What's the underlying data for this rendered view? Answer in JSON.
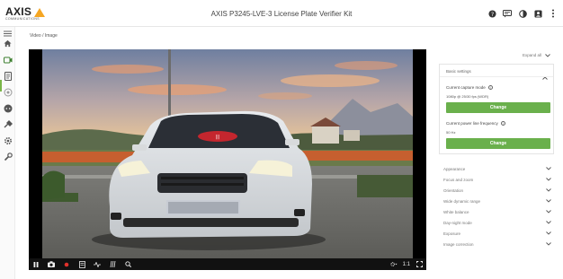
{
  "header": {
    "logo_text": "AXIS",
    "logo_subtext": "COMMUNICATIONS",
    "title": "AXIS P3245-LVE-3 License Plate Verifier Kit"
  },
  "breadcrumb": "Video / Image",
  "viewer": {
    "resolution_label": "1:1"
  },
  "panel": {
    "expand_all": "Expand all",
    "basic_settings": {
      "title": "Basic settings",
      "capture_mode_label": "Current capture mode",
      "capture_mode_value": "1080p @ 25/30 fps (WDR)",
      "change_label": "Change",
      "power_line_label": "Current power line frequency",
      "power_line_value": "50 Hz"
    },
    "sections": [
      "Appearance",
      "Focus and zoom",
      "Orientation",
      "Wide dynamic range",
      "White balance",
      "Day-night mode",
      "Exposure",
      "Image correction"
    ]
  },
  "colors": {
    "accent_green": "#6ab04c",
    "logo_yellow": "#f5a623"
  }
}
